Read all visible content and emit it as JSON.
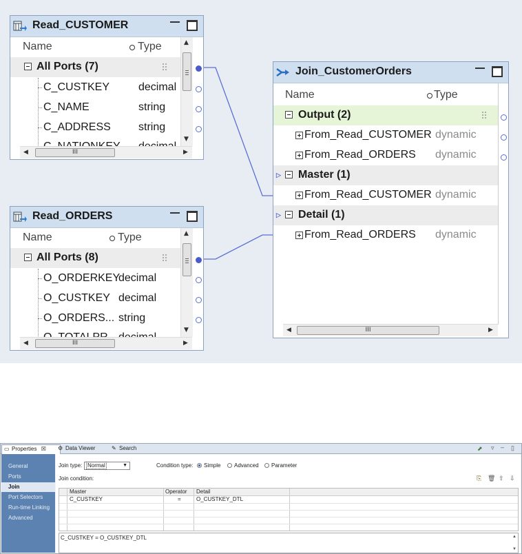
{
  "canvas": {
    "read_customer": {
      "title": "Read_CUSTOMER",
      "col_name": "Name",
      "col_type": "Type",
      "group_label": "All Ports (7)",
      "ports": [
        {
          "name": "C_CUSTKEY",
          "type": "decimal"
        },
        {
          "name": "C_NAME",
          "type": "string"
        },
        {
          "name": "C_ADDRESS",
          "type": "string"
        },
        {
          "name": "C_NATIONKEY",
          "type": "decimal"
        }
      ],
      "hscroll_label": "III"
    },
    "read_orders": {
      "title": "Read_ORDERS",
      "col_name": "Name",
      "col_type": "Type",
      "group_label": "All Ports (8)",
      "ports": [
        {
          "name": "O_ORDERKEY",
          "type": "decimal"
        },
        {
          "name": "O_CUSTKEY",
          "type": "decimal"
        },
        {
          "name": "O_ORDERS...",
          "type": "string"
        },
        {
          "name": "O_TOTALPR",
          "type": "decimal"
        }
      ],
      "hscroll_label": "III"
    },
    "joiner": {
      "title": "Join_CustomerOrders",
      "col_name": "Name",
      "col_type": "Type",
      "groups": [
        {
          "label": "Output (2)",
          "ports": [
            {
              "name": "From_Read_CUSTOMER",
              "type": "dynamic"
            },
            {
              "name": "From_Read_ORDERS",
              "type": "dynamic"
            }
          ]
        },
        {
          "label": "Master (1)",
          "ports": [
            {
              "name": "From_Read_CUSTOMER",
              "type": "dynamic"
            }
          ]
        },
        {
          "label": "Detail (1)",
          "ports": [
            {
              "name": "From_Read_ORDERS",
              "type": "dynamic"
            }
          ]
        }
      ],
      "hscroll_label": "III"
    },
    "colors": {
      "canvas_bg": "#e8edf3",
      "link": "#5a6ed6",
      "output_group_bg": "#e6f5d8"
    }
  },
  "properties": {
    "tabs": [
      {
        "label": "Properties",
        "icon": "properties-icon",
        "suffix": "☒"
      },
      {
        "label": "Data Viewer",
        "icon": "data-viewer-icon"
      },
      {
        "label": "Search",
        "icon": "search-icon"
      }
    ],
    "nav": [
      "General",
      "Ports",
      "Join",
      "Port Selectors",
      "Run-time Linking",
      "Advanced"
    ],
    "selected_nav": "Join",
    "join_type_label": "Join type:",
    "join_type_value": "Normal",
    "condition_type_label": "Condition type:",
    "condition_options": [
      "Simple",
      "Advanced",
      "Parameter"
    ],
    "condition_selected": "Simple",
    "join_condition_label": "Join condition:",
    "grid_headers": [
      "Master",
      "Operator",
      "Detail"
    ],
    "grid_rows": [
      {
        "master": "C_CUSTKEY",
        "operator": "=",
        "detail": "O_CUSTKEY_DTL"
      }
    ],
    "expression": "C_CUSTKEY = O_CUSTKEY_DTL"
  }
}
